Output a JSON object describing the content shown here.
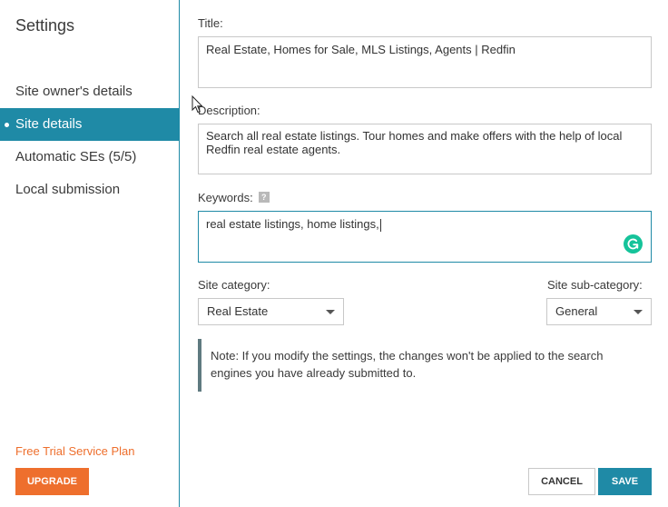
{
  "sidebar": {
    "title": "Settings",
    "items": [
      {
        "label": "Site owner's details",
        "active": false
      },
      {
        "label": "Site details",
        "active": true
      },
      {
        "label": "Automatic SEs (5/5)",
        "active": false
      },
      {
        "label": "Local submission",
        "active": false
      }
    ],
    "plan_label": "Free Trial Service Plan",
    "upgrade_label": "UPGRADE"
  },
  "form": {
    "title_label": "Title:",
    "title_value": "Real Estate, Homes for Sale, MLS Listings, Agents | Redfin",
    "description_label": "Description:",
    "description_value": "Search all real estate listings. Tour homes and make offers with the help of local Redfin real estate agents.",
    "keywords_label": "Keywords:",
    "keywords_help": "?",
    "keywords_value": "real estate listings, home listings,",
    "category_label": "Site category:",
    "category_value": "Real Estate",
    "subcategory_label": "Site sub-category:",
    "subcategory_value": "General",
    "note": "Note: If you modify the settings, the changes won't be applied to the search engines you have already submitted to."
  },
  "actions": {
    "cancel_label": "CANCEL",
    "save_label": "SAVE"
  },
  "colors": {
    "accent": "#1f8aa6",
    "upgrade": "#ee6f2d",
    "grammarly": "#15c39a"
  }
}
